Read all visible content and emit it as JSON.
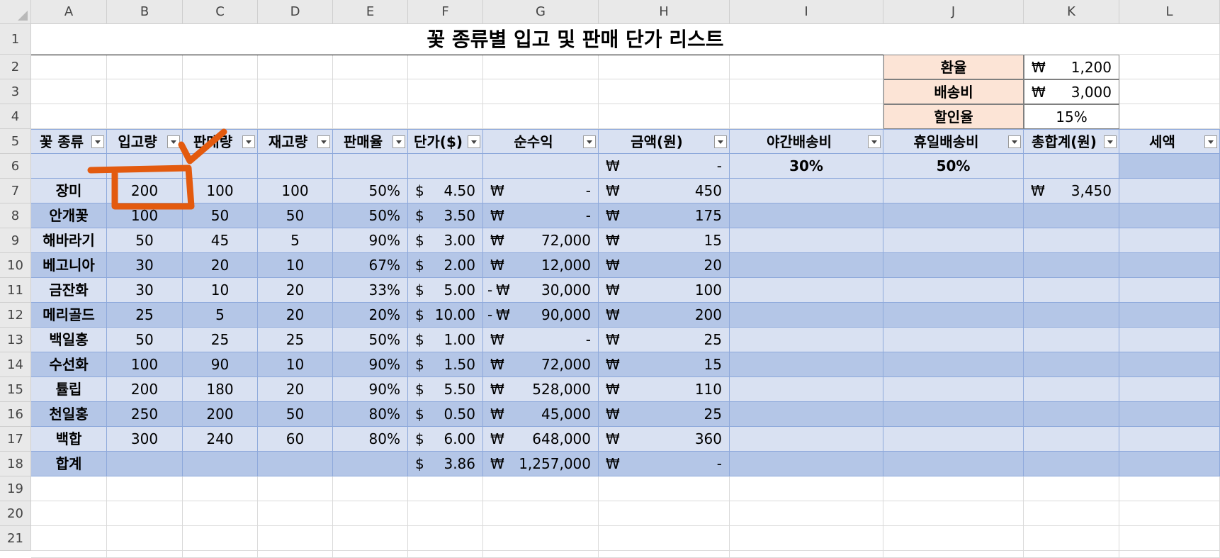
{
  "columns": [
    "A",
    "B",
    "C",
    "D",
    "E",
    "F",
    "G",
    "H",
    "I",
    "J",
    "K",
    "L"
  ],
  "rows": [
    "1",
    "2",
    "3",
    "4",
    "5",
    "6",
    "7",
    "8",
    "9",
    "10",
    "11",
    "12",
    "13",
    "14",
    "15",
    "16",
    "17",
    "18",
    "19",
    "20",
    "21"
  ],
  "title": "꽃 종류별 입고 및 판매 단가 리스트",
  "params": [
    {
      "label": "환율",
      "cur": "₩",
      "value": "1,200"
    },
    {
      "label": "배송비",
      "cur": "₩",
      "value": "3,000"
    },
    {
      "label": "할인율",
      "cur": "",
      "value": "15%"
    }
  ],
  "headers": [
    "꽃 종류",
    "입고량",
    "판매량",
    "재고량",
    "판매율",
    "단가($)",
    "순수익",
    "금액(원)",
    "야간배송비",
    "휴일배송비",
    "총합계(원)",
    "세액"
  ],
  "row6": {
    "H_cur": "₩",
    "H_val": "-",
    "I": "30%",
    "J": "50%"
  },
  "data": [
    {
      "name": "장미",
      "in": "200",
      "sold": "100",
      "stock": "100",
      "rate": "50%",
      "price": "4.50",
      "neg": "",
      "profit": "-",
      "amount": "450",
      "k_cur": "₩",
      "total": "3,450"
    },
    {
      "name": "안개꽃",
      "in": "100",
      "sold": "50",
      "stock": "50",
      "rate": "50%",
      "price": "3.50",
      "neg": "",
      "profit": "-",
      "amount": "175",
      "k_cur": "",
      "total": ""
    },
    {
      "name": "해바라기",
      "in": "50",
      "sold": "45",
      "stock": "5",
      "rate": "90%",
      "price": "3.00",
      "neg": "",
      "profit": "72,000",
      "amount": "15",
      "k_cur": "",
      "total": ""
    },
    {
      "name": "베고니아",
      "in": "30",
      "sold": "20",
      "stock": "10",
      "rate": "67%",
      "price": "2.00",
      "neg": "",
      "profit": "12,000",
      "amount": "20",
      "k_cur": "",
      "total": ""
    },
    {
      "name": "금잔화",
      "in": "30",
      "sold": "10",
      "stock": "20",
      "rate": "33%",
      "price": "5.00",
      "neg": "-",
      "profit": "30,000",
      "amount": "100",
      "k_cur": "",
      "total": ""
    },
    {
      "name": "메리골드",
      "in": "25",
      "sold": "5",
      "stock": "20",
      "rate": "20%",
      "price": "10.00",
      "neg": "-",
      "profit": "90,000",
      "amount": "200",
      "k_cur": "",
      "total": ""
    },
    {
      "name": "백일홍",
      "in": "50",
      "sold": "25",
      "stock": "25",
      "rate": "50%",
      "price": "1.00",
      "neg": "",
      "profit": "-",
      "amount": "25",
      "k_cur": "",
      "total": ""
    },
    {
      "name": "수선화",
      "in": "100",
      "sold": "90",
      "stock": "10",
      "rate": "90%",
      "price": "1.50",
      "neg": "",
      "profit": "72,000",
      "amount": "15",
      "k_cur": "",
      "total": ""
    },
    {
      "name": "튤립",
      "in": "200",
      "sold": "180",
      "stock": "20",
      "rate": "90%",
      "price": "5.50",
      "neg": "",
      "profit": "528,000",
      "amount": "110",
      "k_cur": "",
      "total": ""
    },
    {
      "name": "천일홍",
      "in": "250",
      "sold": "200",
      "stock": "50",
      "rate": "80%",
      "price": "0.50",
      "neg": "",
      "profit": "45,000",
      "amount": "25",
      "k_cur": "",
      "total": ""
    },
    {
      "name": "백합",
      "in": "300",
      "sold": "240",
      "stock": "60",
      "rate": "80%",
      "price": "6.00",
      "neg": "",
      "profit": "648,000",
      "amount": "360",
      "k_cur": "",
      "total": ""
    }
  ],
  "total": {
    "name": "합계",
    "price": "3.86",
    "profit": "1,257,000",
    "amount": "-"
  },
  "symbols": {
    "dollar": "$",
    "won": "₩"
  },
  "colors": {
    "band_light": "#d9e1f2",
    "band_dark": "#b4c6e7",
    "param_fill": "#fce4d6",
    "annotation": "#e35a0e"
  }
}
